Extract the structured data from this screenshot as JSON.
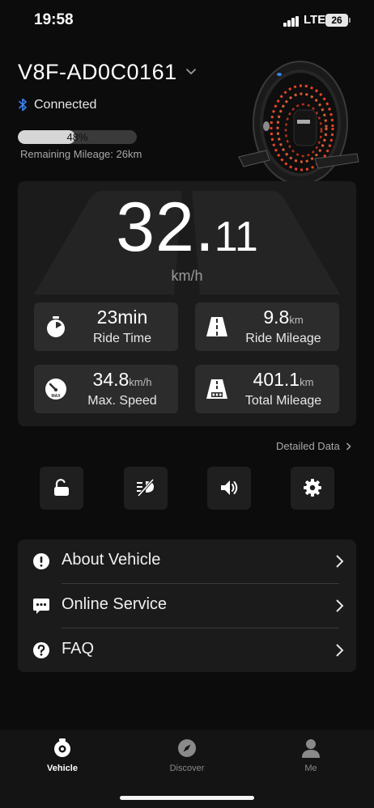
{
  "status_bar": {
    "time": "19:58",
    "network": "LTE",
    "battery": "26"
  },
  "device": {
    "name": "V8F-AD0C0161",
    "connection": "Connected",
    "battery_percent": 48,
    "battery_label": "48%",
    "remaining_mileage": "Remaining Mileage: 26km"
  },
  "speed": {
    "integer": "32",
    "dot": ".",
    "decimal": "11",
    "unit": "km/h"
  },
  "stats": [
    {
      "value": "23min",
      "unit": "",
      "label": "Ride Time",
      "icon": "stopwatch-icon"
    },
    {
      "value": "9.8",
      "unit": "km",
      "label": "Ride Mileage",
      "icon": "road-icon"
    },
    {
      "value": "34.8",
      "unit": "km/h",
      "label": "Max. Speed",
      "icon": "speedometer-max-icon"
    },
    {
      "value": "401.1",
      "unit": "km",
      "label": "Total Mileage",
      "icon": "road-odometer-icon"
    }
  ],
  "detailed_data_label": "Detailed Data",
  "quick_actions": [
    "unlock-icon",
    "lights-off-icon",
    "sound-icon",
    "settings-gear-icon"
  ],
  "menu": [
    {
      "label": "About Vehicle",
      "icon": "info-icon"
    },
    {
      "label": "Online Service",
      "icon": "chat-icon"
    },
    {
      "label": "FAQ",
      "icon": "question-icon"
    }
  ],
  "tabs": [
    {
      "label": "Vehicle",
      "icon": "wheel-icon",
      "active": true
    },
    {
      "label": "Discover",
      "icon": "compass-icon",
      "active": false
    },
    {
      "label": "Me",
      "icon": "person-icon",
      "active": false
    }
  ],
  "colors": {
    "background": "#0c0c0c",
    "card": "#1b1b1b",
    "tile": "#2c2c2c",
    "bluetooth": "#3b82f6",
    "wheel_led": "#ff4a2a"
  }
}
